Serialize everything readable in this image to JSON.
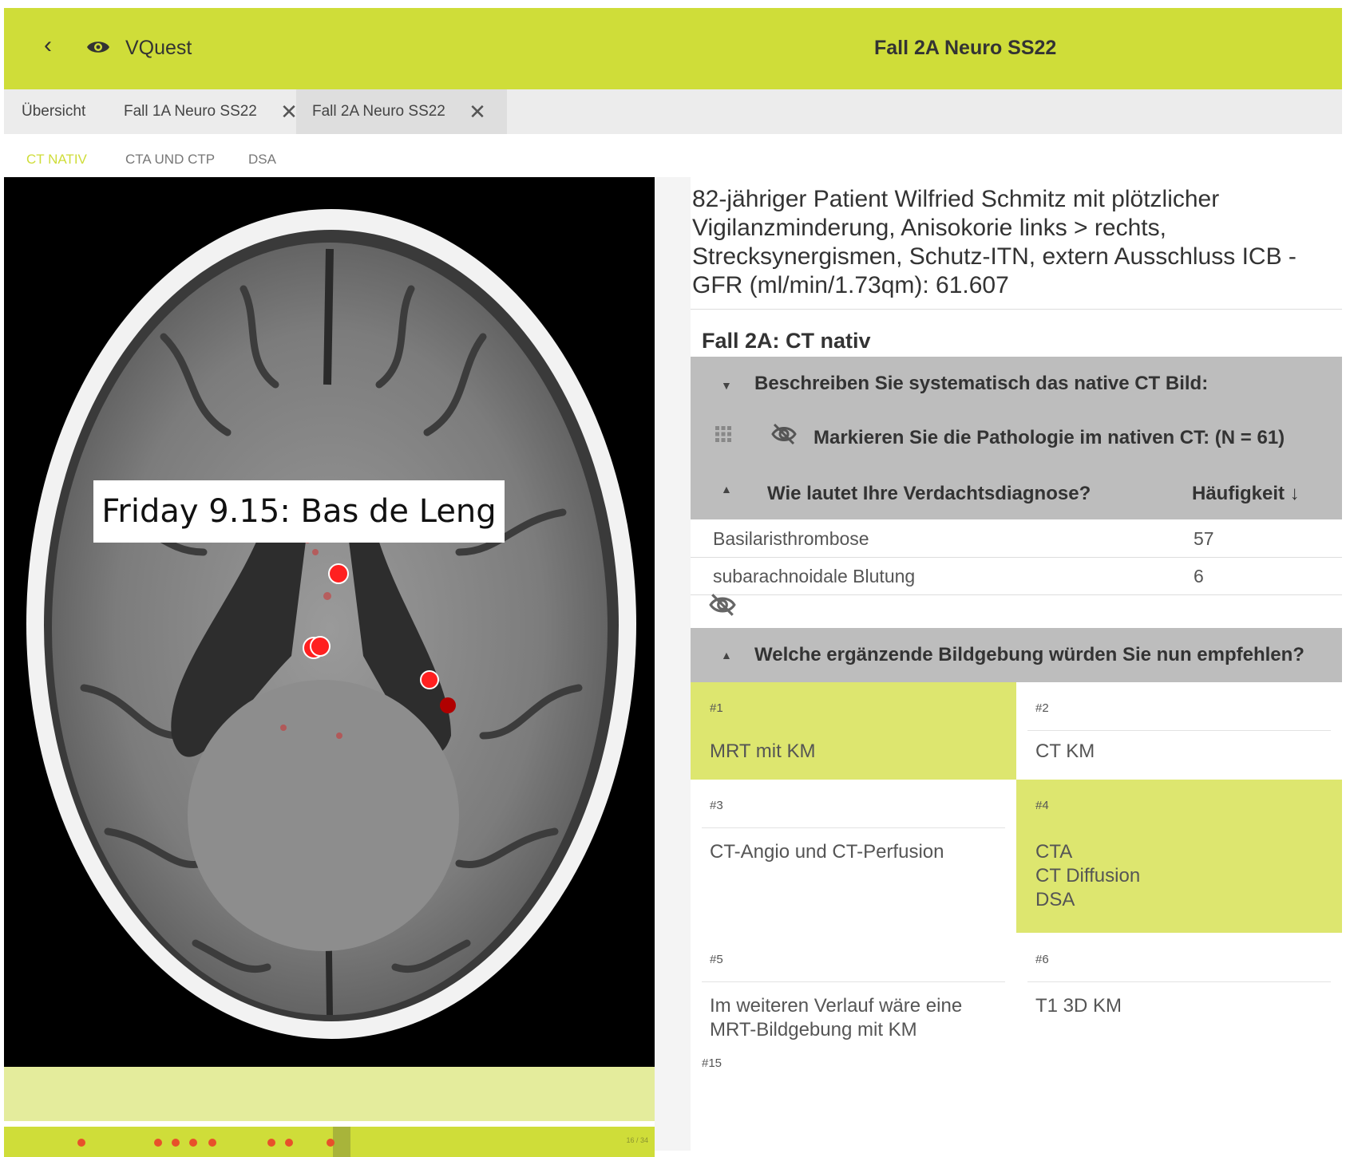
{
  "header": {
    "back_icon": "chevron-left-icon",
    "logo_icon": "eye-icon",
    "app_name": "VQuest",
    "title": "Fall 2A Neuro SS22",
    "accent_color": "#cfdd39"
  },
  "tabs": [
    {
      "label": "Übersicht"
    },
    {
      "label": "Fall 1A Neuro SS22",
      "close": "X"
    },
    {
      "label": "Fall 2A Neuro SS22",
      "close": "X"
    }
  ],
  "subtabs": [
    {
      "label": "CT NATIV"
    },
    {
      "label": "CTA UND CTP"
    },
    {
      "label": "DSA"
    }
  ],
  "viewer": {
    "overlay_label": "Friday 9.15: Bas de Leng",
    "slice_indicator": "16 / 34"
  },
  "panel": {
    "case_description": "82-jähriger Patient Wilfried Schmitz mit plötzlicher Vigilanzminderung, Anisokorie links > rechts, Strecksynergismen, Schutz-ITN, extern Ausschluss ICB - GFR (ml/min/1.73qm): 61.607",
    "section_title": "Fall 2A: CT nativ",
    "q1": "Beschreiben Sie systematisch das native CT Bild:",
    "q2": "Markieren Sie die Pathologie im nativen CT: (N = 61)",
    "q3": "Wie lautet Ihre Verdachtsdiagnose?",
    "q3_header": "Häufigkeit ↓",
    "diagnoses": [
      {
        "label": "Basilaristhrombose",
        "count": "57"
      },
      {
        "label": "subarachnoidale Blutung",
        "count": "6"
      }
    ],
    "q4": "Welche ergänzende Bildgebung würden Sie nun empfehlen?",
    "answers": [
      {
        "num": "#1",
        "text": "MRT mit KM"
      },
      {
        "num": "#2",
        "text": "CT KM"
      },
      {
        "num": "#3",
        "text": "CT-Angio und CT-Perfusion"
      },
      {
        "num": "#4",
        "text": "CTA\nCT Diffusion\nDSA"
      },
      {
        "num": "#5",
        "text": "Im weiteren Verlauf wäre eine\nMRT-Bildgebung mit KM"
      },
      {
        "num": "#6",
        "text": "T1 3D KM"
      }
    ],
    "last_num": "#15"
  }
}
